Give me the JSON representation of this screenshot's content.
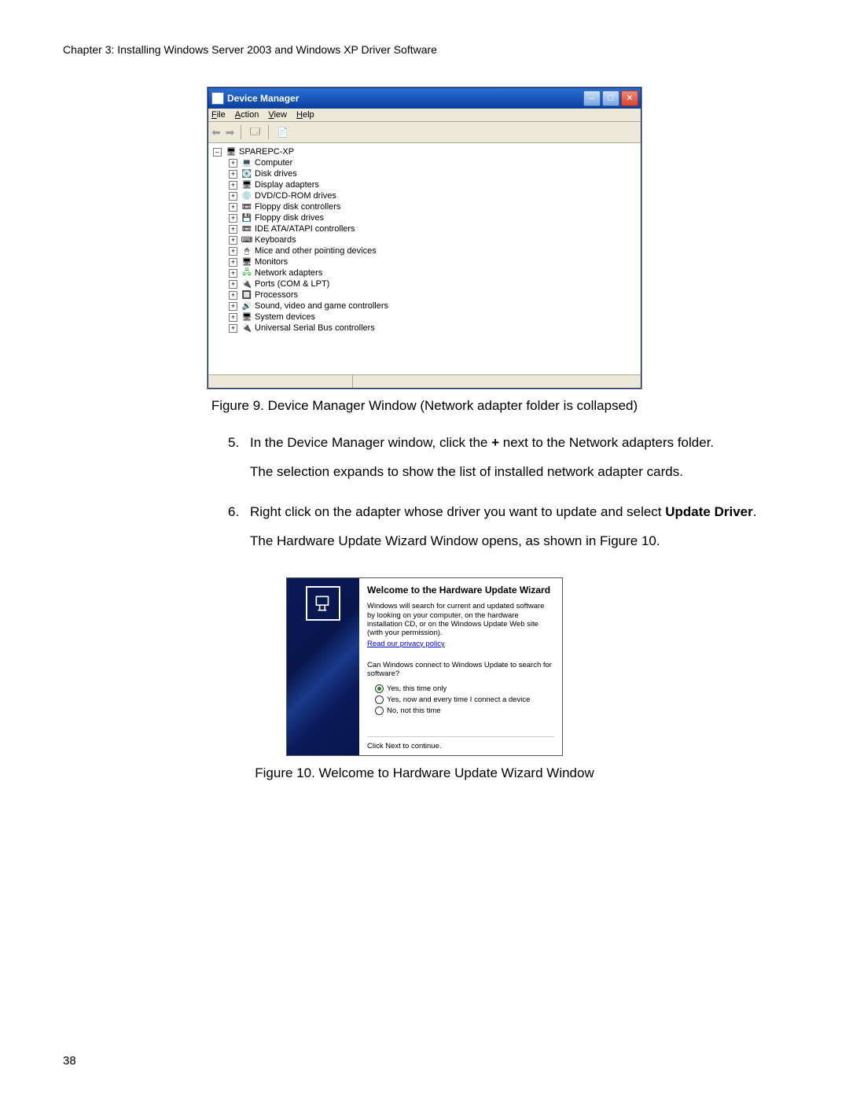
{
  "header": "Chapter 3: Installing Windows Server 2003 and Windows XP Driver Software",
  "page_number": "38",
  "device_manager": {
    "title": "Device Manager",
    "menus": {
      "file": "File",
      "action": "Action",
      "view": "View",
      "help": "Help"
    },
    "root": "SPAREPC-XP",
    "nodes": [
      "Computer",
      "Disk drives",
      "Display adapters",
      "DVD/CD-ROM drives",
      "Floppy disk controllers",
      "Floppy disk drives",
      "IDE ATA/ATAPI controllers",
      "Keyboards",
      "Mice and other pointing devices",
      "Monitors",
      "Network adapters",
      "Ports (COM & LPT)",
      "Processors",
      "Sound, video and game controllers",
      "System devices",
      "Universal Serial Bus controllers"
    ]
  },
  "figure9_caption": "Figure 9. Device Manager Window (Network adapter folder is collapsed)",
  "step5": {
    "num": "5.",
    "text_a": "In the Device Manager window, click the ",
    "plus": "+",
    "text_b": " next to the Network adapters folder.",
    "para2": "The selection expands to show the list of installed network adapter cards."
  },
  "step6": {
    "num": "6.",
    "text_a": "Right click on the adapter whose driver you want to update and select ",
    "bold": "Update Driver",
    "text_b": ".",
    "para2": "The Hardware Update Wizard Window opens, as shown in Figure 10."
  },
  "wizard": {
    "title": "Welcome to the Hardware Update Wizard",
    "para": "Windows will search for current and updated software by looking on your computer, on the hardware installation CD, or on the Windows Update Web site (with your permission).",
    "link": "Read our privacy policy",
    "question": "Can Windows connect to Windows Update to search for software?",
    "opts": [
      "Yes, this time only",
      "Yes, now and every time I connect a device",
      "No, not this time"
    ],
    "bottom": "Click Next to continue."
  },
  "figure10_caption": "Figure 10. Welcome to Hardware Update Wizard Window"
}
